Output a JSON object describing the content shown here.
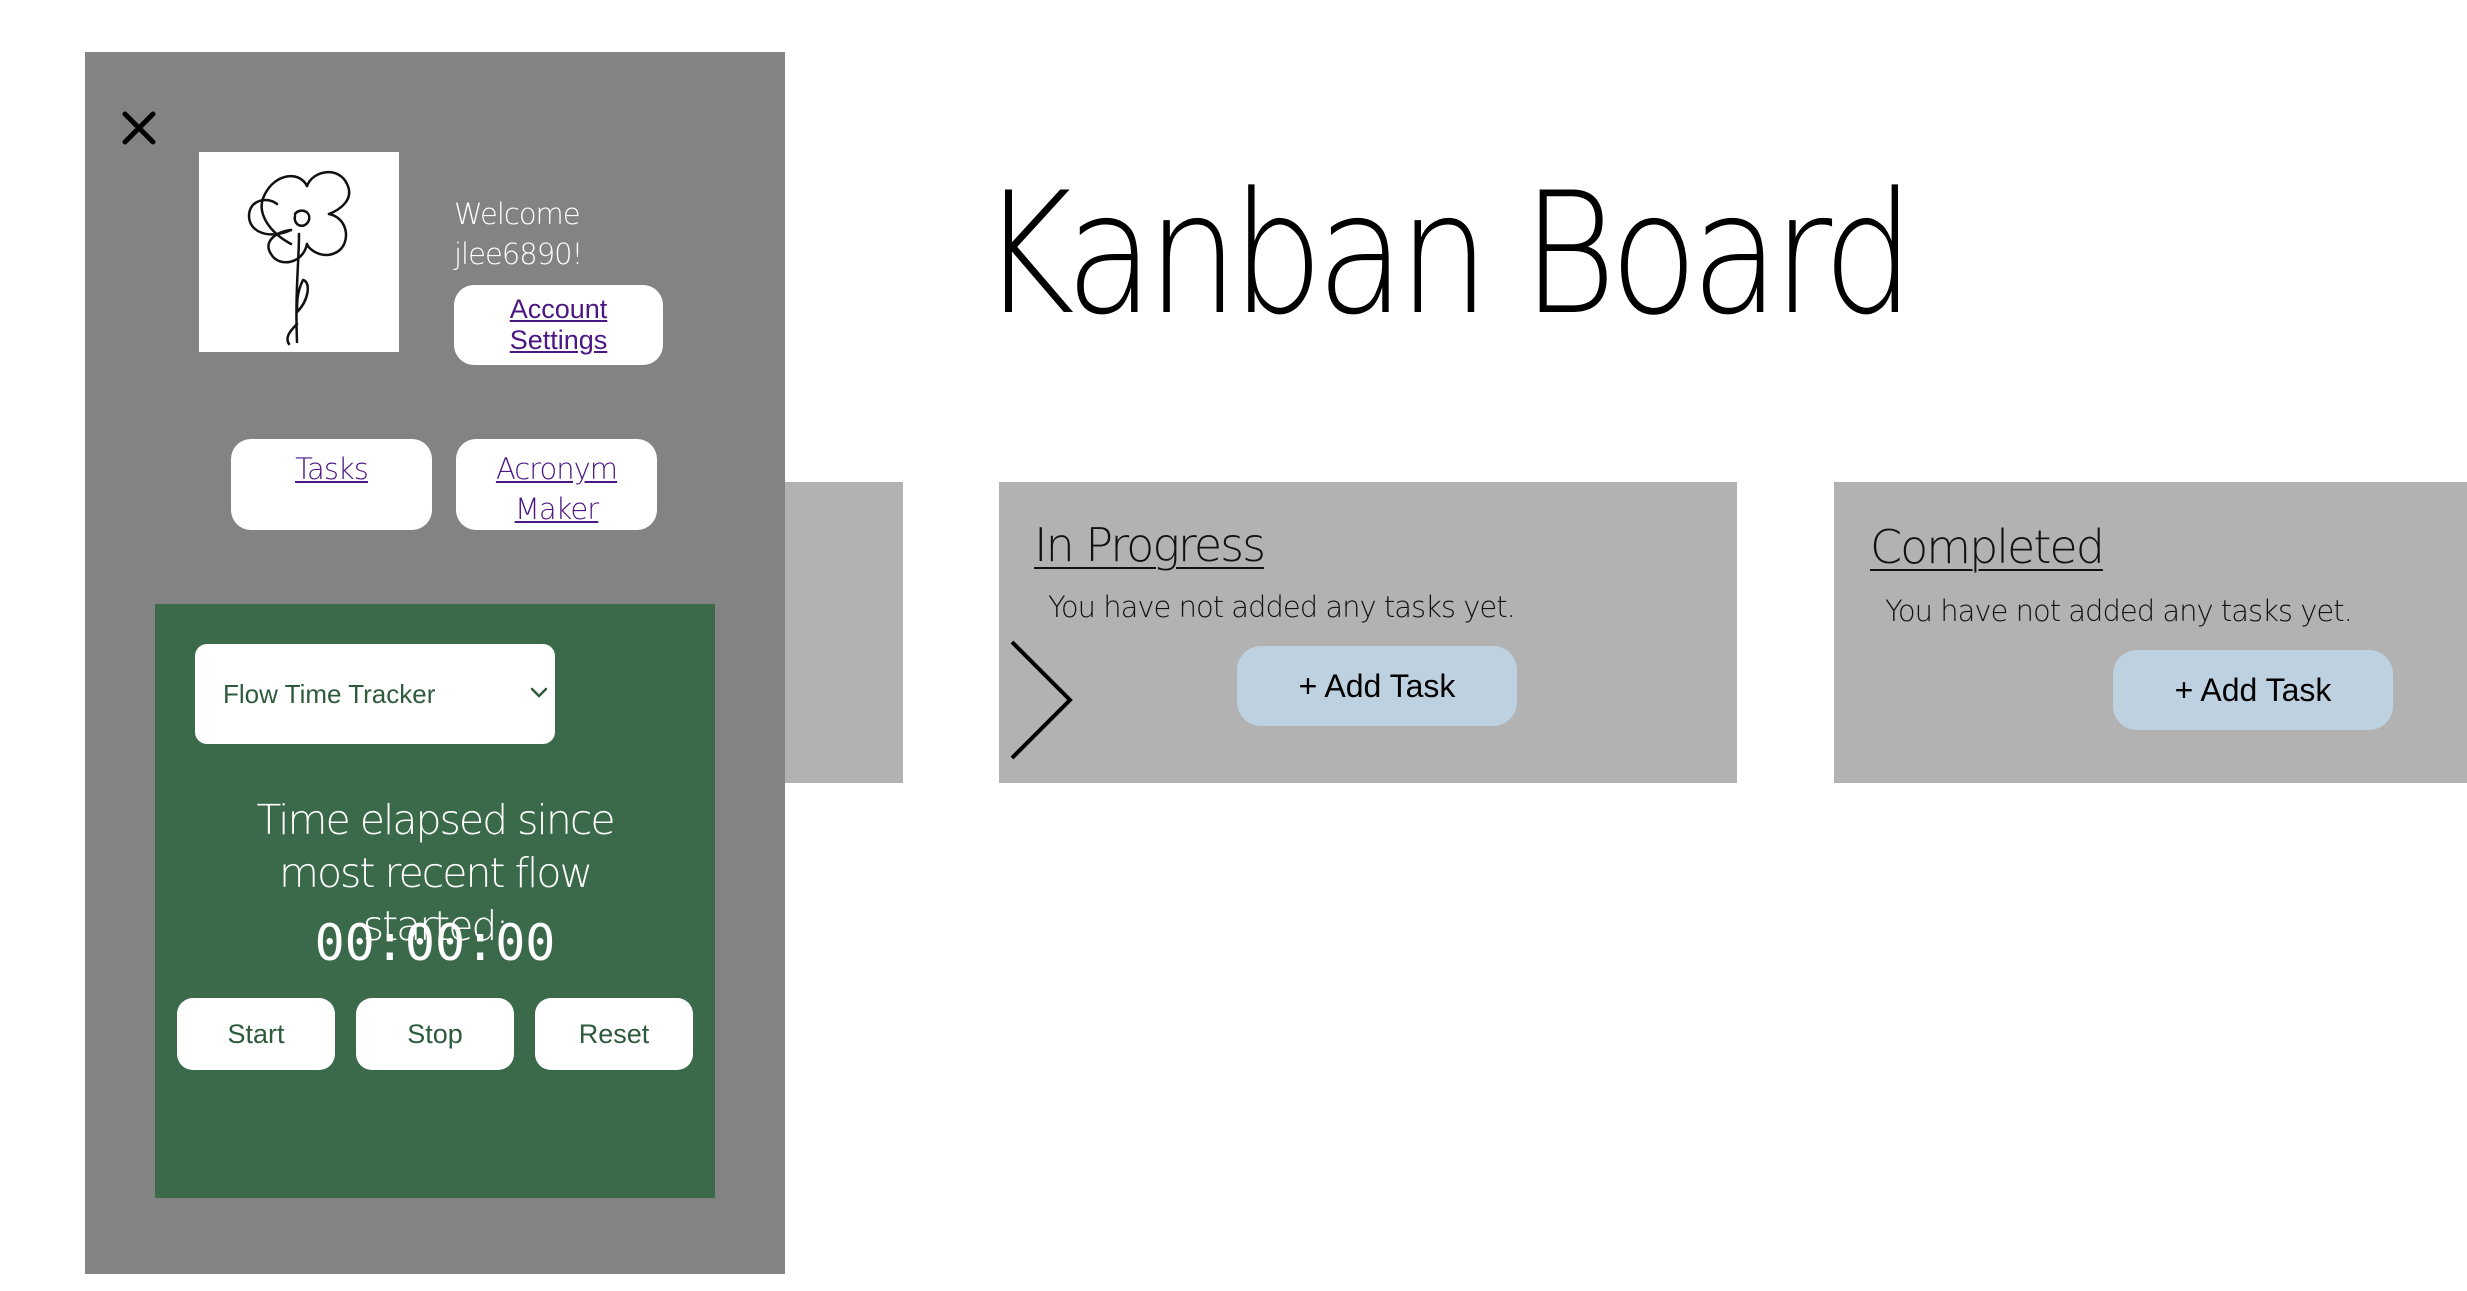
{
  "board": {
    "title": "Kanban Board",
    "columns": [
      {
        "title": "In Progress",
        "empty_text": "You have not added any tasks yet.",
        "add_label": "+ Add Task"
      },
      {
        "title": "Completed",
        "empty_text": "You have not added any tasks yet.",
        "add_label": "+ Add Task"
      }
    ]
  },
  "sidebar": {
    "welcome_line1": "Welcome",
    "username": "jlee6890!",
    "account_settings": "Account Settings",
    "nav": [
      {
        "label": "Tasks"
      },
      {
        "label": "Acronym Maker"
      }
    ]
  },
  "tracker": {
    "selected": "Flow Time Tracker",
    "elapsed_label": "Time elapsed since most recent flow started:",
    "elapsed_time": "00:00:00",
    "start_label": "Start",
    "stop_label": "Stop",
    "reset_label": "Reset"
  },
  "icons": {
    "close": "close-icon",
    "avatar": "flower-icon",
    "dropdown": "chevron-down-icon",
    "arrow": "chevron-right-icon"
  },
  "colors": {
    "sidebar_bg": "#838383",
    "tracker_bg": "#3b6a4a",
    "column_bg": "#b2b2b2",
    "add_button_bg": "#bdd1e0",
    "link_color": "#4b1782"
  }
}
